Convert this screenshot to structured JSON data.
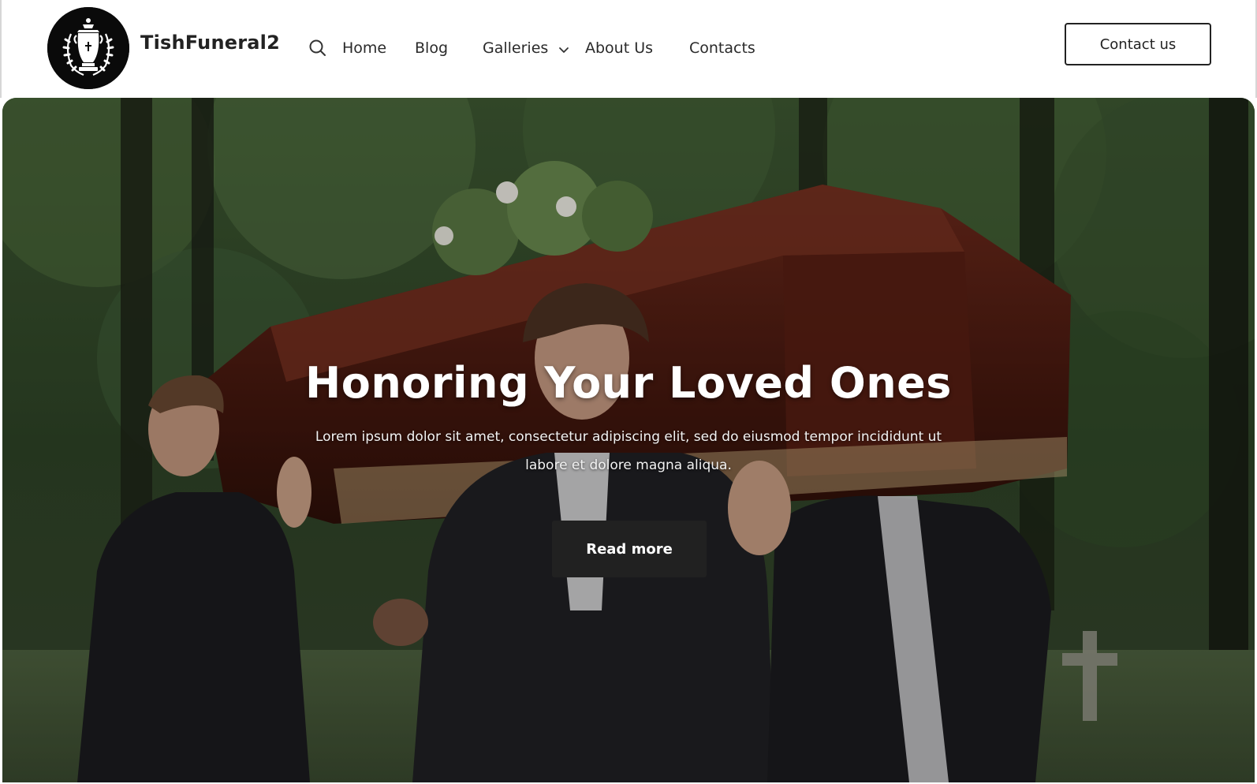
{
  "header": {
    "brand": "TishFuneral2",
    "nav": {
      "home": "Home",
      "blog": "Blog",
      "galleries": "Galleries",
      "about": "About Us",
      "contacts": "Contacts"
    },
    "contact_button": "Contact us",
    "icons": {
      "logo": "funeral-urn-logo",
      "search": "search-icon",
      "galleries_dropdown": "chevron-down-icon"
    }
  },
  "hero": {
    "title": "Honoring Your Loved Ones",
    "subtitle": "Lorem ipsum dolor sit amet, consectetur adipiscing elit, sed do eiusmod tempor incididunt ut labore et dolore magna aliqua.",
    "button": "Read more",
    "image": "pallbearers carrying a wooden casket with flowers through a wooded cemetery"
  },
  "colors": {
    "text": "#222222",
    "hero_text": "#ffffff",
    "button_dark": "#212121",
    "logo_bg": "#0a0a0a"
  }
}
